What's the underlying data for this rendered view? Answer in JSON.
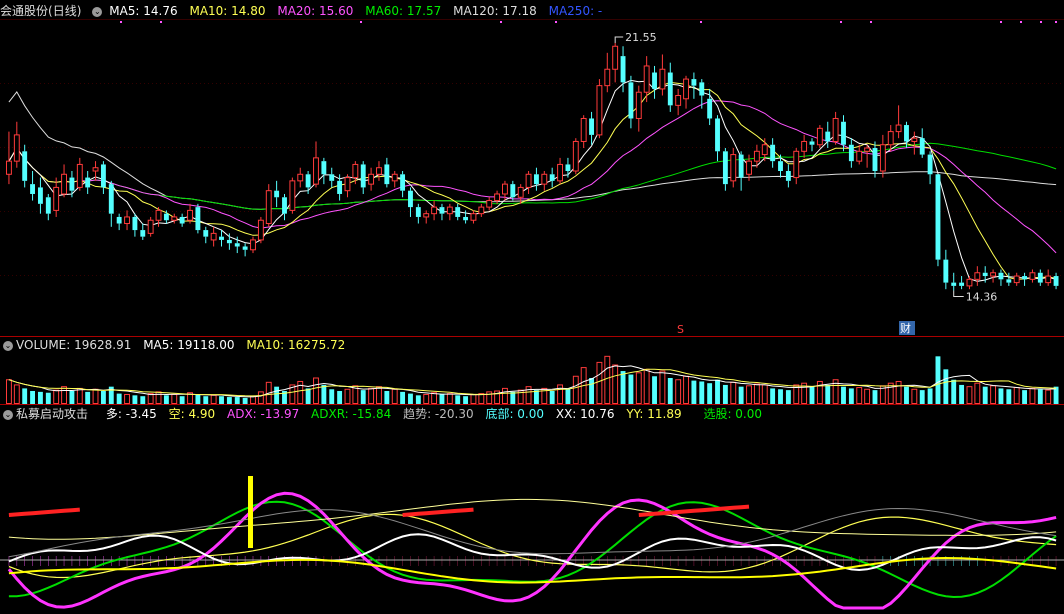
{
  "colors": {
    "up": "#ff3b3b",
    "down": "#54ffff",
    "ma5": "#ffffff",
    "ma10": "#ffff54",
    "ma20": "#ff54ff",
    "ma60": "#00dd00",
    "ma120": "#dddddd",
    "ma250": "#3333ff",
    "panel_line": "#aa0000",
    "bg": "#000000"
  },
  "price_header": {
    "stock": "会通股份",
    "period": "(日线)",
    "ma5": "MA5: 14.76",
    "ma10": "MA10: 14.80",
    "ma20": "MA20: 15.60",
    "ma60": "MA60: 17.57",
    "ma120": "MA120: 17.18",
    "ma250": "MA250: -"
  },
  "volume_header": {
    "volume": "VOLUME: 19628.91",
    "ma5": "MA5: 19118.00",
    "ma10": "MA10: 16275.72"
  },
  "indicator_header": {
    "name": "私募启动攻击",
    "duo": "多: -3.45",
    "kong": "空: 4.90",
    "adx": "ADX: -13.97",
    "adxr": "ADXR: -15.84",
    "trend": "趋势: -20.30",
    "bottom": "底部: 0.00",
    "xx": "XX: 10.76",
    "yy": "YY: 11.89",
    "select": "选股: 0.00"
  },
  "annotations": {
    "high_label": "21.55",
    "low_label": "14.36",
    "marker_s": "S",
    "marker_cai": "财"
  },
  "chart_data": [
    {
      "type": "candlestick",
      "title": "会通股份(日线)",
      "price_range": [
        13.4,
        22.6
      ],
      "high_point": 21.55,
      "low_point": 14.36,
      "moving_averages": {
        "MA5": 14.76,
        "MA10": 14.8,
        "MA20": 15.6,
        "MA60": 17.57,
        "MA120": 17.18,
        "MA250": null
      },
      "candles": [
        [
          17.9,
          18.3,
          19.2,
          17.6
        ],
        [
          18.3,
          19.1,
          19.5,
          18.1
        ],
        [
          18.6,
          17.7,
          18.8,
          17.5
        ],
        [
          17.6,
          17.3,
          18.0,
          17.1
        ],
        [
          17.5,
          17.0,
          17.8,
          16.7
        ],
        [
          17.2,
          16.7,
          17.3,
          16.5
        ],
        [
          16.8,
          17.5,
          17.8,
          16.6
        ],
        [
          17.3,
          17.9,
          18.2,
          17.2
        ],
        [
          17.8,
          17.4,
          18.0,
          17.2
        ],
        [
          17.5,
          18.2,
          18.4,
          17.4
        ],
        [
          17.8,
          17.5,
          18.0,
          17.3
        ],
        [
          18.0,
          18.1,
          18.3,
          17.7
        ],
        [
          18.2,
          17.5,
          18.3,
          17.3
        ],
        [
          17.6,
          16.7,
          17.7,
          16.3
        ],
        [
          16.6,
          16.4,
          16.7,
          16.2
        ],
        [
          16.4,
          16.6,
          16.8,
          16.2
        ],
        [
          16.6,
          16.2,
          16.7,
          16.0
        ],
        [
          16.2,
          16.0,
          16.4,
          15.9
        ],
        [
          16.1,
          16.5,
          16.6,
          16.0
        ],
        [
          16.5,
          16.8,
          16.9,
          16.3
        ],
        [
          16.7,
          16.5,
          16.8,
          16.4
        ],
        [
          16.5,
          16.6,
          16.7,
          16.4
        ],
        [
          16.6,
          16.4,
          16.7,
          16.3
        ],
        [
          16.5,
          16.8,
          17.0,
          16.4
        ],
        [
          16.9,
          16.2,
          17.0,
          16.1
        ],
        [
          16.2,
          16.0,
          16.3,
          15.8
        ],
        [
          15.9,
          16.1,
          16.3,
          15.7
        ],
        [
          16.0,
          15.9,
          16.2,
          15.7
        ],
        [
          15.9,
          15.8,
          16.1,
          15.6
        ],
        [
          15.8,
          15.7,
          16.0,
          15.5
        ],
        [
          15.7,
          15.6,
          15.8,
          15.4
        ],
        [
          15.6,
          15.9,
          16.0,
          15.5
        ],
        [
          15.9,
          16.5,
          16.6,
          15.8
        ],
        [
          16.4,
          17.4,
          17.6,
          16.3
        ],
        [
          17.4,
          17.2,
          17.7,
          16.9
        ],
        [
          17.2,
          16.7,
          17.3,
          16.5
        ],
        [
          16.8,
          17.7,
          17.8,
          16.7
        ],
        [
          17.7,
          17.9,
          18.1,
          17.5
        ],
        [
          17.9,
          17.5,
          18.0,
          17.3
        ],
        [
          17.6,
          18.4,
          18.9,
          17.5
        ],
        [
          18.3,
          17.9,
          18.4,
          17.6
        ],
        [
          17.9,
          17.7,
          18.1,
          17.5
        ],
        [
          17.7,
          17.3,
          17.9,
          17.1
        ],
        [
          17.4,
          17.8,
          17.9,
          17.2
        ],
        [
          17.8,
          18.2,
          18.3,
          17.6
        ],
        [
          18.2,
          17.5,
          18.3,
          17.3
        ],
        [
          17.6,
          17.9,
          18.1,
          17.4
        ],
        [
          17.9,
          18.1,
          18.3,
          17.7
        ],
        [
          18.2,
          17.6,
          18.4,
          17.5
        ],
        [
          17.7,
          17.9,
          18.0,
          17.5
        ],
        [
          17.9,
          17.4,
          18.0,
          17.2
        ],
        [
          17.4,
          16.9,
          17.5,
          16.6
        ],
        [
          16.9,
          16.6,
          17.0,
          16.4
        ],
        [
          16.6,
          16.7,
          16.8,
          16.4
        ],
        [
          16.7,
          16.9,
          17.1,
          16.5
        ],
        [
          16.9,
          16.7,
          17.0,
          16.5
        ],
        [
          16.7,
          16.9,
          17.0,
          16.5
        ],
        [
          16.9,
          16.6,
          17.0,
          16.5
        ],
        [
          16.6,
          16.5,
          16.8,
          16.4
        ],
        [
          16.5,
          16.7,
          16.8,
          16.4
        ],
        [
          16.7,
          16.9,
          17.0,
          16.6
        ],
        [
          16.9,
          17.1,
          17.2,
          16.8
        ],
        [
          17.1,
          17.3,
          17.4,
          17.0
        ],
        [
          17.3,
          17.6,
          17.7,
          17.1
        ],
        [
          17.6,
          17.2,
          17.7,
          17.1
        ],
        [
          17.2,
          17.5,
          17.6,
          17.0
        ],
        [
          17.5,
          17.9,
          18.0,
          17.3
        ],
        [
          17.9,
          17.6,
          18.1,
          17.4
        ],
        [
          17.6,
          17.9,
          18.0,
          17.4
        ],
        [
          17.9,
          17.7,
          18.1,
          17.5
        ],
        [
          17.7,
          18.2,
          18.4,
          17.6
        ],
        [
          18.2,
          18.0,
          18.4,
          17.8
        ],
        [
          18.0,
          18.9,
          19.0,
          17.9
        ],
        [
          18.9,
          19.6,
          19.7,
          18.7
        ],
        [
          19.6,
          19.1,
          19.8,
          18.8
        ],
        [
          19.1,
          20.6,
          20.8,
          19.0
        ],
        [
          20.6,
          21.1,
          21.6,
          20.4
        ],
        [
          21.1,
          21.8,
          21.9,
          20.7
        ],
        [
          21.5,
          20.7,
          21.8,
          20.4
        ],
        [
          20.7,
          19.6,
          20.9,
          19.3
        ],
        [
          19.6,
          20.4,
          20.6,
          19.2
        ],
        [
          20.4,
          21.2,
          21.5,
          20.1
        ],
        [
          21.0,
          20.5,
          21.2,
          20.2
        ],
        [
          20.5,
          21.1,
          21.55,
          20.3
        ],
        [
          21.0,
          20.0,
          21.3,
          19.8
        ],
        [
          20.0,
          20.3,
          20.5,
          19.7
        ],
        [
          20.2,
          20.8,
          20.9,
          19.9
        ],
        [
          20.8,
          20.6,
          21.0,
          20.2
        ],
        [
          20.7,
          20.3,
          20.8,
          19.9
        ],
        [
          20.2,
          19.6,
          20.5,
          19.4
        ],
        [
          19.6,
          18.6,
          19.7,
          18.3
        ],
        [
          18.6,
          17.6,
          18.7,
          17.4
        ],
        [
          17.7,
          18.5,
          18.7,
          17.5
        ],
        [
          18.5,
          17.8,
          18.6,
          17.4
        ],
        [
          17.9,
          18.3,
          18.5,
          17.7
        ],
        [
          18.3,
          18.6,
          18.8,
          18.1
        ],
        [
          18.5,
          18.8,
          19.0,
          18.3
        ],
        [
          18.8,
          18.3,
          19.0,
          18.1
        ],
        [
          18.3,
          18.0,
          18.5,
          17.8
        ],
        [
          18.0,
          17.7,
          18.2,
          17.5
        ],
        [
          17.8,
          18.6,
          18.7,
          17.6
        ],
        [
          18.6,
          18.9,
          19.1,
          18.4
        ],
        [
          18.9,
          18.8,
          19.0,
          18.6
        ],
        [
          18.8,
          19.3,
          19.4,
          18.7
        ],
        [
          19.2,
          18.9,
          19.5,
          18.7
        ],
        [
          18.9,
          19.6,
          19.8,
          18.8
        ],
        [
          19.5,
          18.8,
          19.7,
          18.6
        ],
        [
          18.8,
          18.3,
          19.0,
          18.1
        ],
        [
          18.3,
          18.6,
          18.8,
          18.2
        ],
        [
          18.6,
          18.7,
          18.8,
          18.1
        ],
        [
          18.7,
          18.0,
          18.9,
          17.8
        ],
        [
          18.0,
          18.8,
          19.1,
          17.8
        ],
        [
          18.8,
          19.2,
          19.4,
          18.6
        ],
        [
          19.2,
          19.4,
          20.0,
          19.0
        ],
        [
          19.4,
          18.9,
          19.5,
          18.7
        ],
        [
          18.9,
          19.0,
          19.2,
          18.5
        ],
        [
          19.0,
          18.5,
          19.3,
          18.4
        ],
        [
          18.5,
          17.9,
          18.6,
          17.6
        ],
        [
          17.9,
          15.3,
          17.9,
          15.1
        ],
        [
          15.3,
          14.6,
          15.6,
          14.4
        ],
        [
          14.6,
          14.5,
          14.9,
          14.36
        ],
        [
          14.6,
          14.5,
          14.8,
          14.4
        ],
        [
          14.5,
          14.7,
          14.8,
          14.4
        ],
        [
          14.7,
          14.9,
          15.1,
          14.5
        ],
        [
          14.9,
          14.8,
          15.1,
          14.6
        ],
        [
          14.8,
          14.9,
          15.0,
          14.6
        ],
        [
          14.9,
          14.7,
          15.0,
          14.5
        ],
        [
          14.7,
          14.6,
          14.9,
          14.5
        ],
        [
          14.6,
          14.8,
          14.9,
          14.5
        ],
        [
          14.8,
          14.7,
          14.9,
          14.5
        ],
        [
          14.7,
          14.9,
          15.0,
          14.6
        ],
        [
          14.9,
          14.6,
          15.0,
          14.5
        ],
        [
          14.6,
          14.8,
          15.0,
          14.5
        ],
        [
          14.8,
          14.5,
          14.9,
          14.4
        ]
      ]
    },
    {
      "type": "bar",
      "title": "VOLUME",
      "latest": 19628.91,
      "ma5": 19118.0,
      "ma10": 16275.72,
      "values": [
        28,
        22,
        18,
        15,
        14,
        13,
        16,
        20,
        15,
        18,
        14,
        17,
        15,
        20,
        12,
        11,
        10,
        9,
        12,
        14,
        10,
        11,
        9,
        13,
        11,
        9,
        10,
        9,
        8,
        8,
        7,
        9,
        14,
        25,
        20,
        15,
        22,
        26,
        18,
        30,
        22,
        17,
        15,
        17,
        21,
        16,
        18,
        20,
        15,
        17,
        14,
        12,
        10,
        11,
        13,
        11,
        12,
        10,
        9,
        11,
        12,
        14,
        15,
        18,
        14,
        16,
        20,
        16,
        18,
        15,
        22,
        18,
        32,
        42,
        30,
        48,
        55,
        45,
        38,
        34,
        36,
        40,
        32,
        38,
        30,
        28,
        32,
        27,
        26,
        24,
        28,
        22,
        25,
        20,
        21,
        23,
        22,
        18,
        17,
        16,
        22,
        24,
        20,
        26,
        22,
        28,
        20,
        18,
        19,
        17,
        16,
        21,
        24,
        26,
        20,
        17,
        16,
        18,
        55,
        40,
        28,
        22,
        20,
        24,
        20,
        21,
        18,
        17,
        19,
        16,
        18,
        17,
        16,
        20
      ],
      "ylim": [
        0,
        60
      ]
    },
    {
      "type": "line",
      "title": "私募启动攻击",
      "series_count": 7
    }
  ]
}
